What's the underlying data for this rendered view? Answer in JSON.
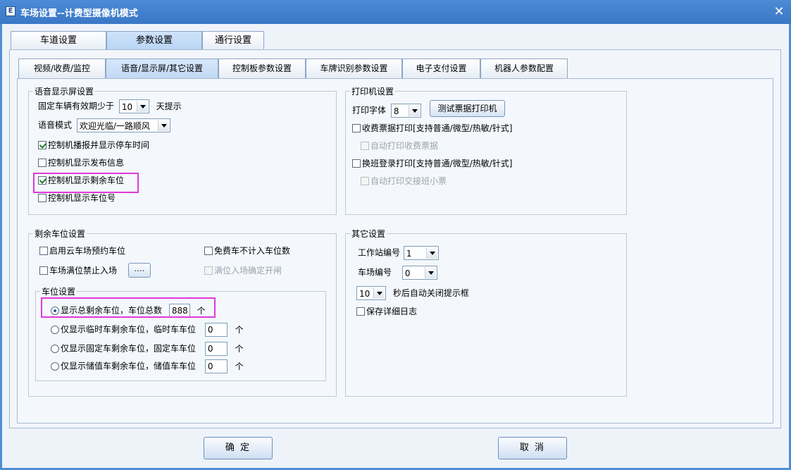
{
  "window": {
    "title": "车场设置--计费型摄像机模式",
    "icon_letter": "E"
  },
  "tabs_top": [
    "车道设置",
    "参数设置",
    "通行设置"
  ],
  "tabs_second": [
    "视频/收费/监控",
    "语音/显示屏/其它设置",
    "控制板参数设置",
    "车牌识别参数设置",
    "电子支付设置",
    "机器人参数配置"
  ],
  "voice_group": {
    "title": "语音显示屏设置",
    "fixed_prefix": "固定车辆有效期少于",
    "fixed_days": "10",
    "fixed_suffix": "天提示",
    "voice_mode_label": "语音模式",
    "voice_mode_value": "欢迎光临/一路顺风",
    "cb_broadcast_parking_time": "控制机播报并显示停车时间",
    "cb_show_publish_info": "控制机显示发布信息",
    "cb_show_remaining": "控制机显示剩余车位",
    "cb_show_space_no": "控制机显示车位号"
  },
  "printer_group": {
    "title": "打印机设置",
    "font_label": "打印字体",
    "font_value": "8",
    "test_print_button": "测试票据打印机",
    "cb_fee_receipt": "收费票据打印[支持普通/微型/热敏/针式]",
    "cb_auto_fee_receipt": "自动打印收费票据",
    "cb_shift_login": "换班登录打印[支持普通/微型/热敏/针式]",
    "cb_auto_shift_ticket": "自动打印交接班小票"
  },
  "remaining_group": {
    "title": "剩余车位设置",
    "cb_cloud_reserve": "启用云车场预约车位",
    "cb_free_not_count": "免费车不计入车位数",
    "cb_full_forbid": "车场满位禁止入场",
    "browse_button": "....",
    "cb_full_confirm_open": "满位入场确定开闸",
    "space_subgroup_title": "车位设置",
    "radio_total_label": "显示总剩余车位，车位总数",
    "radio_total_value": "888",
    "radio_temp_label": "仅显示临时车剩余车位，临时车车位",
    "radio_temp_value": "0",
    "radio_fixed_label": "仅显示固定车剩余车位，固定车车位",
    "radio_fixed_value": "0",
    "radio_stored_label": "仅显示储值车剩余车位，储值车车位",
    "radio_stored_value": "0",
    "unit": "个"
  },
  "other_group": {
    "title": "其它设置",
    "station_label": "工作站编号",
    "station_value": "1",
    "lot_label": "车场编号",
    "lot_value": "0",
    "auto_close_value": "10",
    "auto_close_label": "秒后自动关闭提示框",
    "cb_save_log": "保存详细日志"
  },
  "buttons": {
    "ok": "确 定",
    "cancel": "取 消"
  },
  "colors": {
    "title_bar": "#3a77c6",
    "highlight_box": "#e03ad8"
  }
}
